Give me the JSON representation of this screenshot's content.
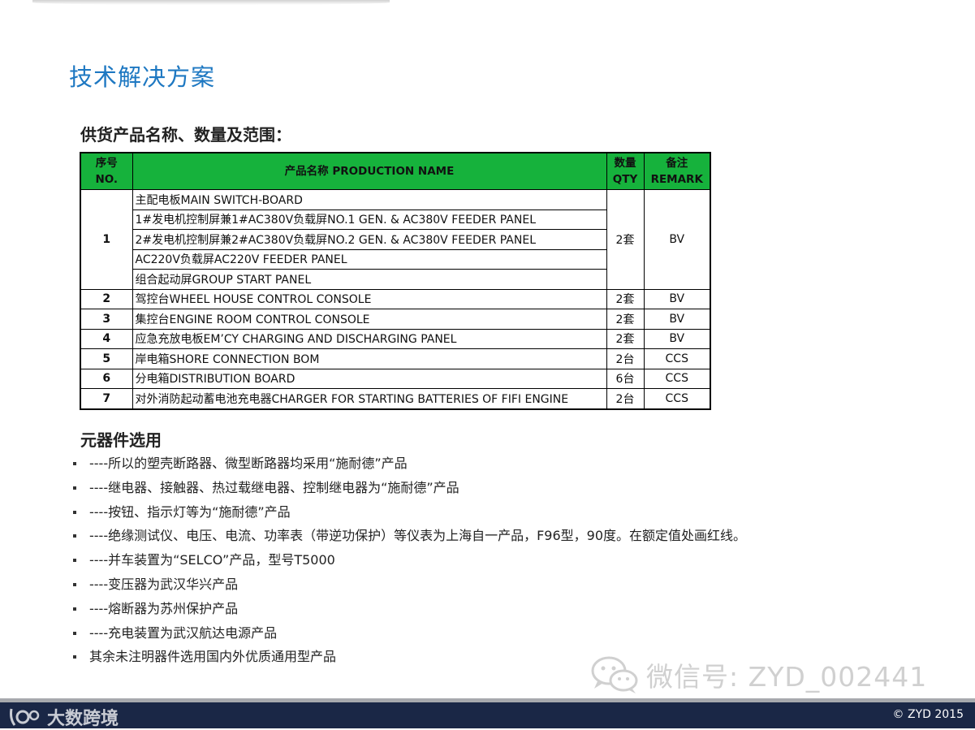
{
  "slide_title": "技术解决方案",
  "section1_heading": "供货产品名称、数量及范围：",
  "table": {
    "headers": {
      "no_cn": "序号",
      "no_en": "NO.",
      "name": "产品名称 PRODUCTION NAME",
      "qty_cn": "数量",
      "qty_en": "QTY",
      "remark_cn": "备注",
      "remark_en": "REMARK"
    },
    "group1": {
      "no": "1",
      "items": [
        "主配电板MAIN SWITCH-BOARD",
        "1#发电机控制屏兼1#AC380V负载屏NO.1 GEN. & AC380V FEEDER PANEL",
        "2#发电机控制屏兼2#AC380V负载屏NO.2 GEN. & AC380V FEEDER PANEL",
        "AC220V负载屏AC220V FEEDER PANEL",
        "组合起动屏GROUP START PANEL"
      ],
      "qty": "2套",
      "remark": "BV"
    },
    "rows": [
      {
        "no": "2",
        "name": "驾控台WHEEL HOUSE CONTROL CONSOLE",
        "qty": "2套",
        "remark": "BV"
      },
      {
        "no": "3",
        "name": "集控台ENGINE ROOM CONTROL CONSOLE",
        "qty": "2套",
        "remark": "BV"
      },
      {
        "no": "4",
        "name": "应急充放电板EM’CY CHARGING AND DISCHARGING PANEL",
        "qty": "2套",
        "remark": "BV"
      },
      {
        "no": "5",
        "name": "岸电箱SHORE CONNECTION BOM",
        "qty": "2台",
        "remark": "CCS"
      },
      {
        "no": "6",
        "name": "分电箱DISTRIBUTION BOARD",
        "qty": "6台",
        "remark": "CCS"
      },
      {
        "no": "7",
        "name": "对外消防起动蓄电池充电器CHARGER FOR STARTING BATTERIES OF FIFI ENGINE",
        "qty": "2台",
        "remark": "CCS"
      }
    ]
  },
  "section2_heading": "元器件选用",
  "components": [
    "----所以的塑壳断路器、微型断路器均采用“施耐德”产品",
    "----继电器、接触器、热过载继电器、控制继电器为“施耐德”产品",
    "----按钮、指示灯等为“施耐德”产品",
    "----绝缘测试仪、电压、电流、功率表（带逆功保护）等仪表为上海自一产品，F96型，90度。在额定值处画红线。",
    "----并车装置为“SELCO”产品，型号T5000",
    "----变压器为武汉华兴产品",
    "----熔断器为苏州保护产品",
    "----充电装置为武汉航达电源产品",
    "其余未注明器件选用国内外优质通用型产品"
  ],
  "watermark_text": "微信号: ZYD_002441",
  "footer": {
    "logo_text": "大数跨境",
    "copyright": "© ZYD 2015"
  },
  "colors": {
    "title": "#1e78c2",
    "table_header": "#16b23c",
    "footer_bg": "#1a2746"
  }
}
